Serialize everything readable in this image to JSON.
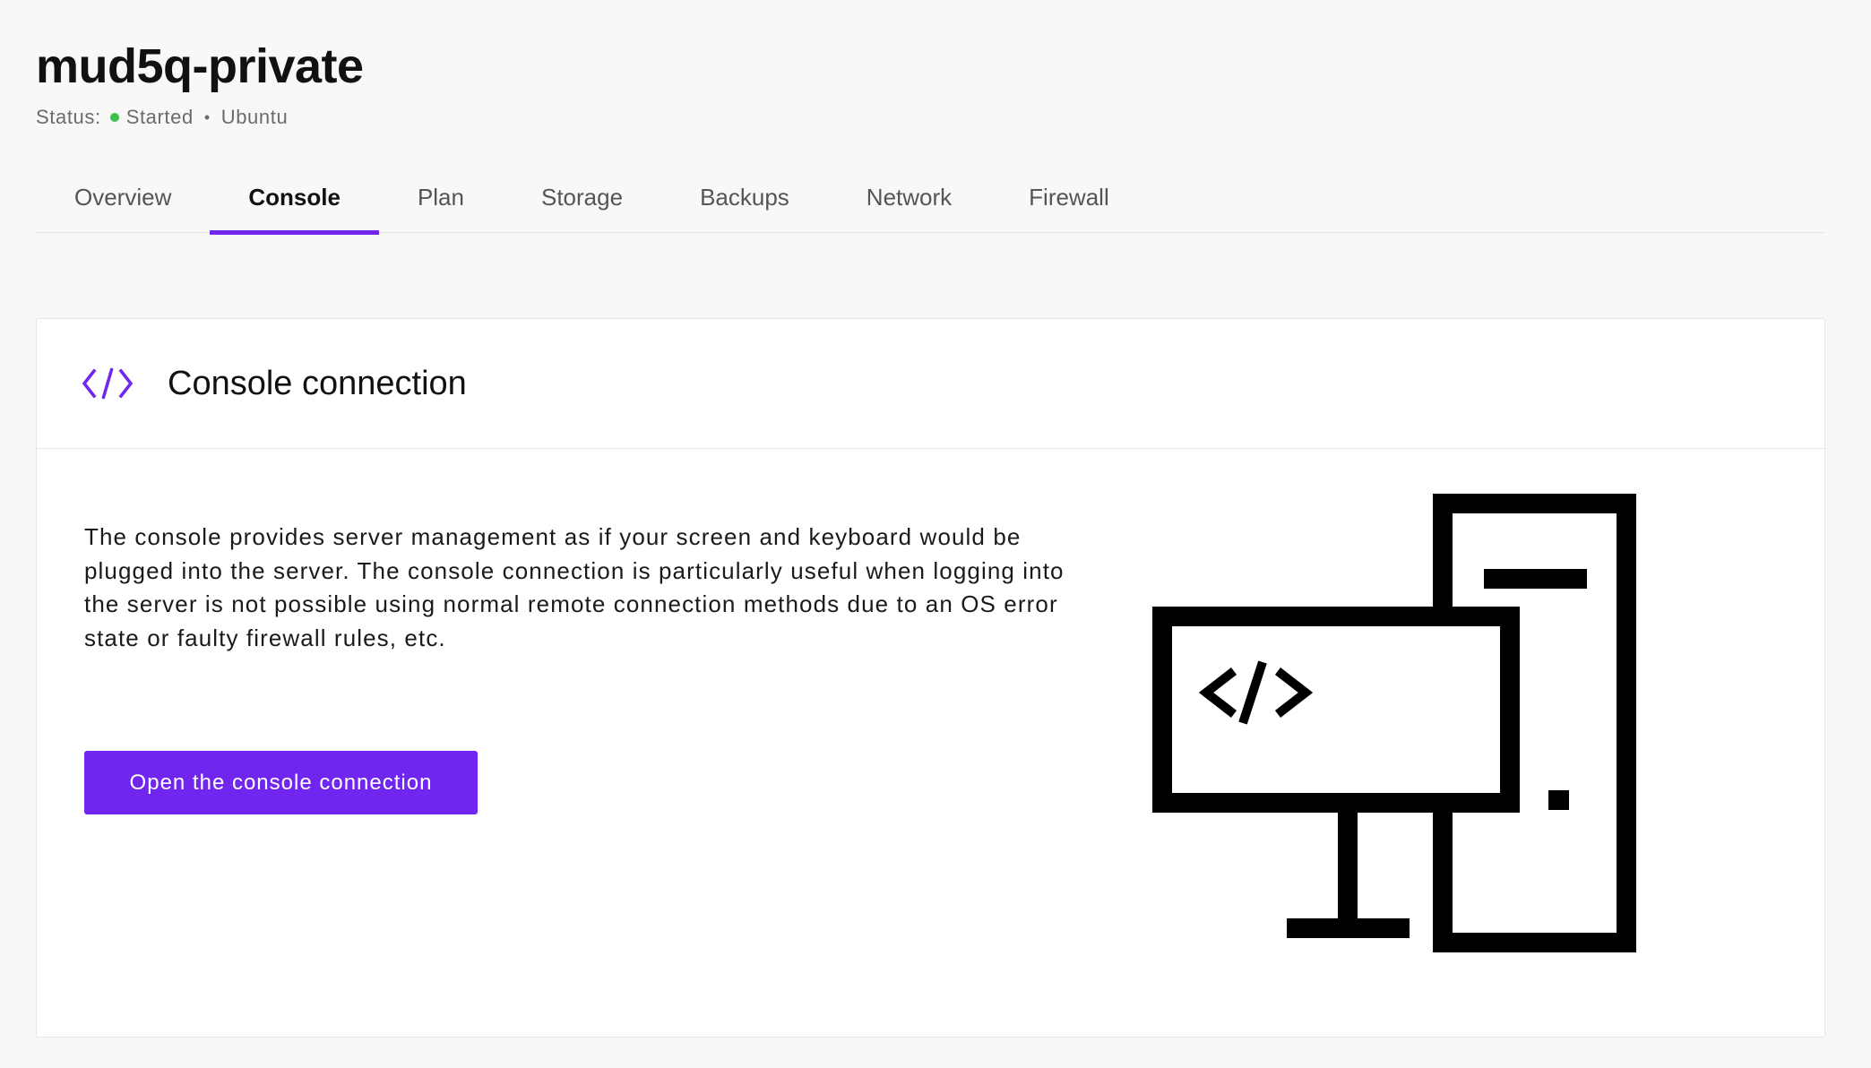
{
  "server": {
    "name": "mud5q-private",
    "status_label": "Status:",
    "status_value": "Started",
    "os": "Ubuntu",
    "status_color": "#3cc24a"
  },
  "tabs": [
    {
      "label": "Overview",
      "active": false
    },
    {
      "label": "Console",
      "active": true
    },
    {
      "label": "Plan",
      "active": false
    },
    {
      "label": "Storage",
      "active": false
    },
    {
      "label": "Backups",
      "active": false
    },
    {
      "label": "Network",
      "active": false
    },
    {
      "label": "Firewall",
      "active": false
    }
  ],
  "card": {
    "icon": "code-brackets-icon",
    "title": "Console connection",
    "description": "The console provides server management as if your screen and keyboard would be plugged into the server. The console connection is particularly useful when logging into the server is not possible using normal remote connection methods due to an OS error state or faulty firewall rules, etc.",
    "button_label": "Open the console connection",
    "illustration": "computer-tower-icon"
  },
  "colors": {
    "accent": "#7126ef",
    "background": "#f8f8f8",
    "card": "#ffffff"
  }
}
